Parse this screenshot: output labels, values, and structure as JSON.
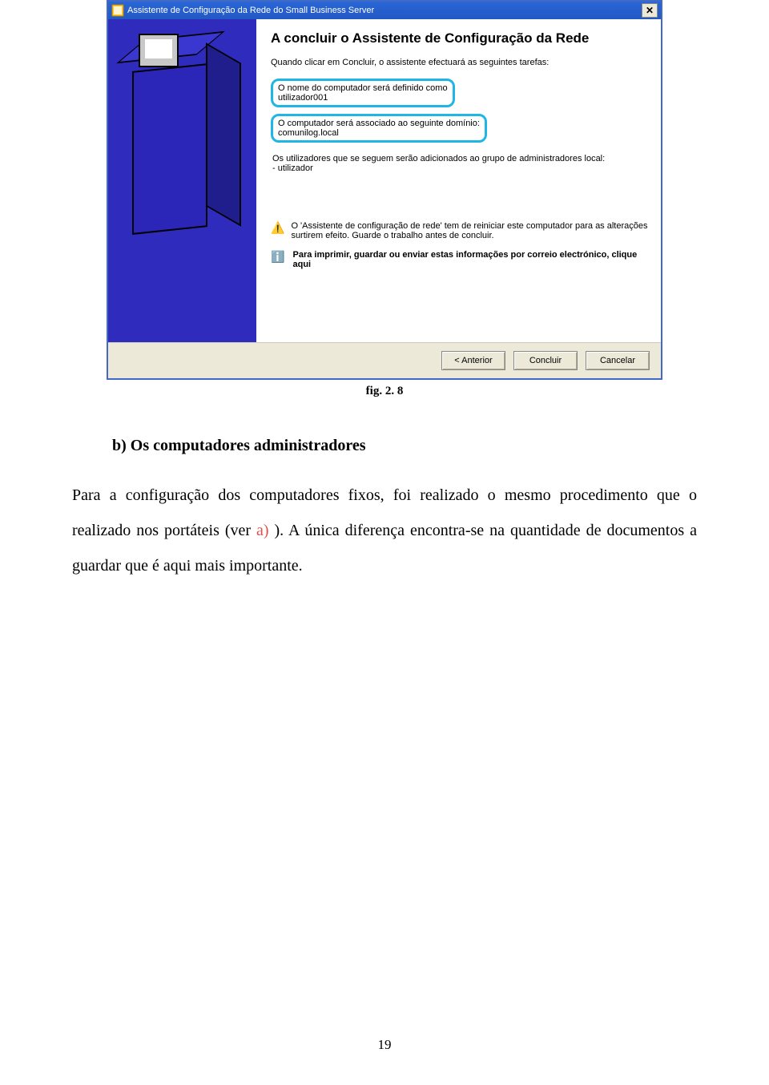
{
  "dialog": {
    "title": "Assistente de Configuração da Rede do Small Business Server",
    "heading": "A concluir o Assistente de Configuração da Rede",
    "intro": "Quando clicar em Concluir, o assistente efectuará as seguintes tarefas:",
    "task1_line1": "O nome do computador será definido como",
    "task1_line2": "utilizador001",
    "task2_line1": "O computador será associado ao seguinte domínio:",
    "task2_line2": "comunilog.local",
    "task3_line1": "Os utilizadores que se seguem serão adicionados ao grupo de administradores local:",
    "task3_line2": "- utilizador",
    "warn": "O 'Assistente de configuração de rede' tem de reiniciar este computador para as alterações surtirem efeito. Guarde o trabalho antes de concluir.",
    "info": "Para imprimir, guardar ou enviar estas informações por correio electrónico, clique aqui",
    "btn_back": "< Anterior",
    "btn_finish": "Concluir",
    "btn_cancel": "Cancelar"
  },
  "figure": {
    "label": "fig. 2. 8"
  },
  "section": {
    "heading": "b)  Os computadores administradores",
    "para_before_ref": "Para a configuração dos computadores fixos, foi realizado o mesmo procedimento que o realizado nos portáteis (ver ",
    "ref": "a)",
    "para_after_ref": " ). A única diferença encontra-se na quantidade de documentos a guardar que é aqui mais importante."
  },
  "page": "19"
}
